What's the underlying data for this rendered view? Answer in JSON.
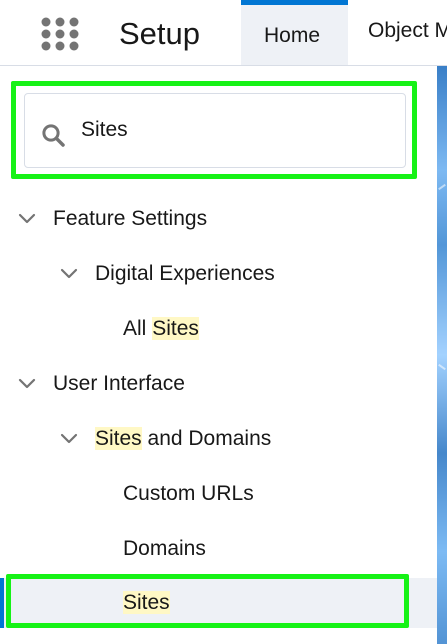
{
  "header": {
    "title": "Setup",
    "tabs": [
      {
        "label": "Home",
        "selected": true
      },
      {
        "label": "Object M",
        "selected": false
      }
    ],
    "accent_color": "#0176d3"
  },
  "search": {
    "value": "Sites",
    "placeholder": ""
  },
  "tree": {
    "feature_settings": {
      "label": "Feature Settings"
    },
    "digital_experiences": {
      "label": "Digital Experiences"
    },
    "all_sites": {
      "prefix": "All ",
      "highlight": "Sites"
    },
    "user_interface": {
      "label": "User Interface"
    },
    "sites_and_domains": {
      "highlight": "Sites",
      "suffix": " and Domains"
    },
    "custom_urls": {
      "label": "Custom URLs"
    },
    "domains": {
      "label": "Domains"
    },
    "sites": {
      "highlight": "Sites"
    }
  },
  "colors": {
    "highlight": "#16f216",
    "search_highlight": "#fff8c5",
    "selected_row": "#eef1f6",
    "text": "#181818"
  },
  "icons": {
    "app_launcher": "grid-icon",
    "search": "search-icon",
    "expand": "chevron-down-icon"
  }
}
